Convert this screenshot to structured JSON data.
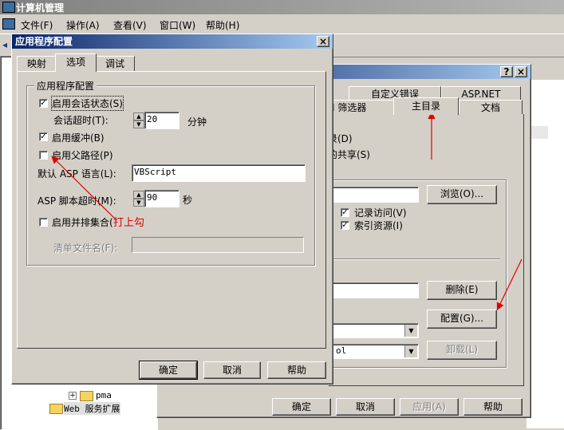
{
  "app": {
    "title": "计算机管理",
    "menu": [
      "文件(F)",
      "操作(A)",
      "查看(V)",
      "窗口(W)",
      "帮助(H)"
    ]
  },
  "back_dialog": {
    "help_button": "?",
    "close_button": "×",
    "tabs_row1": [
      "自定义错误",
      "ASP.NET"
    ],
    "tabs_row2": [
      "I 筛选器",
      "主目录",
      "文档"
    ],
    "partial_texts": [
      "录(D)",
      "的共享(S)",
      ")"
    ],
    "browse_label": "浏览(O)...",
    "log_access_label": "记录访问(V)",
    "index_label": "索引资源(I)",
    "remove_label": "删除(E)",
    "config_label": "配置(G)...",
    "combo2_value": "ol",
    "unload_label": "卸载(L)",
    "ok_label": "确定",
    "cancel_label": "取消",
    "apply_label": "应用(A)",
    "help_label": "帮助"
  },
  "tree": {
    "items": [
      "pma",
      "Web 服务扩展"
    ]
  },
  "dialog": {
    "title": "应用程序配置",
    "close_button": "×",
    "tabs": [
      "映射",
      "选项",
      "调试"
    ],
    "group_label": "应用程序配置",
    "enable_session_label": "启用会话状态(S)",
    "session_timeout_label": "会话超时(T):",
    "session_timeout_value": "20",
    "session_timeout_unit": "分钟",
    "enable_buffer_label": "启用缓冲(B)",
    "enable_parent_paths_label": "启用父路径(P)",
    "default_lang_label": "默认 ASP 语言(L):",
    "default_lang_value": "VBScript",
    "script_timeout_label": "ASP 脚本超时(M):",
    "script_timeout_value": "90",
    "script_timeout_unit": "秒",
    "enable_side_by_side_label": "启用并排集合(",
    "manifest_label": "清单文件名(F):",
    "ok_label": "确定",
    "cancel_label": "取消",
    "help_label": "帮助"
  },
  "annotation": {
    "note": "打上勾",
    "color": "#e00000"
  },
  "checks": {
    "enable_session": true,
    "enable_buffer": true,
    "enable_parent_paths": false,
    "enable_side_by_side": false,
    "log_access": true,
    "index_resources": true
  }
}
